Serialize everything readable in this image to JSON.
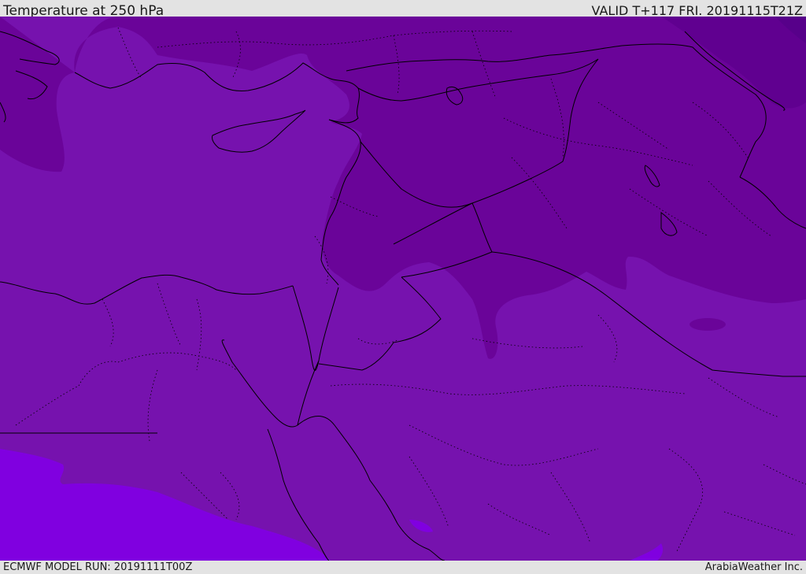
{
  "header": {
    "title": "Temperature at 250 hPa",
    "valid": "VALID T+117 FRI. 20191115T21Z"
  },
  "footer": {
    "model_run": "ECMWF MODEL RUN: 20191111T00Z",
    "credit": "ArabiaWeather Inc."
  },
  "colors": {
    "base_field": "#7612ae",
    "cool_field": "#6a0499",
    "cold_field": "#600090",
    "warm_field": "#8000e0",
    "borders": "#000000",
    "bars": "#e3e3e3"
  }
}
